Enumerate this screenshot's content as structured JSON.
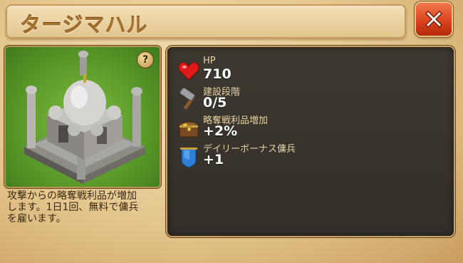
{
  "window": {
    "title": "タージマハル",
    "close_icon": "close-x-icon"
  },
  "building": {
    "image": "taj-mahal-building",
    "help_label": "?"
  },
  "description": "攻撃からの略奪戦利品が増加\nします。1日1回、無料で傭兵\nを雇います。",
  "stats": [
    {
      "icon": "heart-icon",
      "label": "HP",
      "value": "710"
    },
    {
      "icon": "hammer-icon",
      "label": "建設段階",
      "value": "0/5"
    },
    {
      "icon": "treasure-chest-icon",
      "label": "略奪戦利品増加",
      "value": "+2%"
    },
    {
      "icon": "blue-banner-icon",
      "label": "デイリーボーナス傭兵",
      "value": "+1"
    }
  ],
  "colors": {
    "close_button": "#d8401c",
    "panel_bg": "#3a3530",
    "title_text": "#a5712e",
    "stat_label": "#e6d3a3"
  }
}
